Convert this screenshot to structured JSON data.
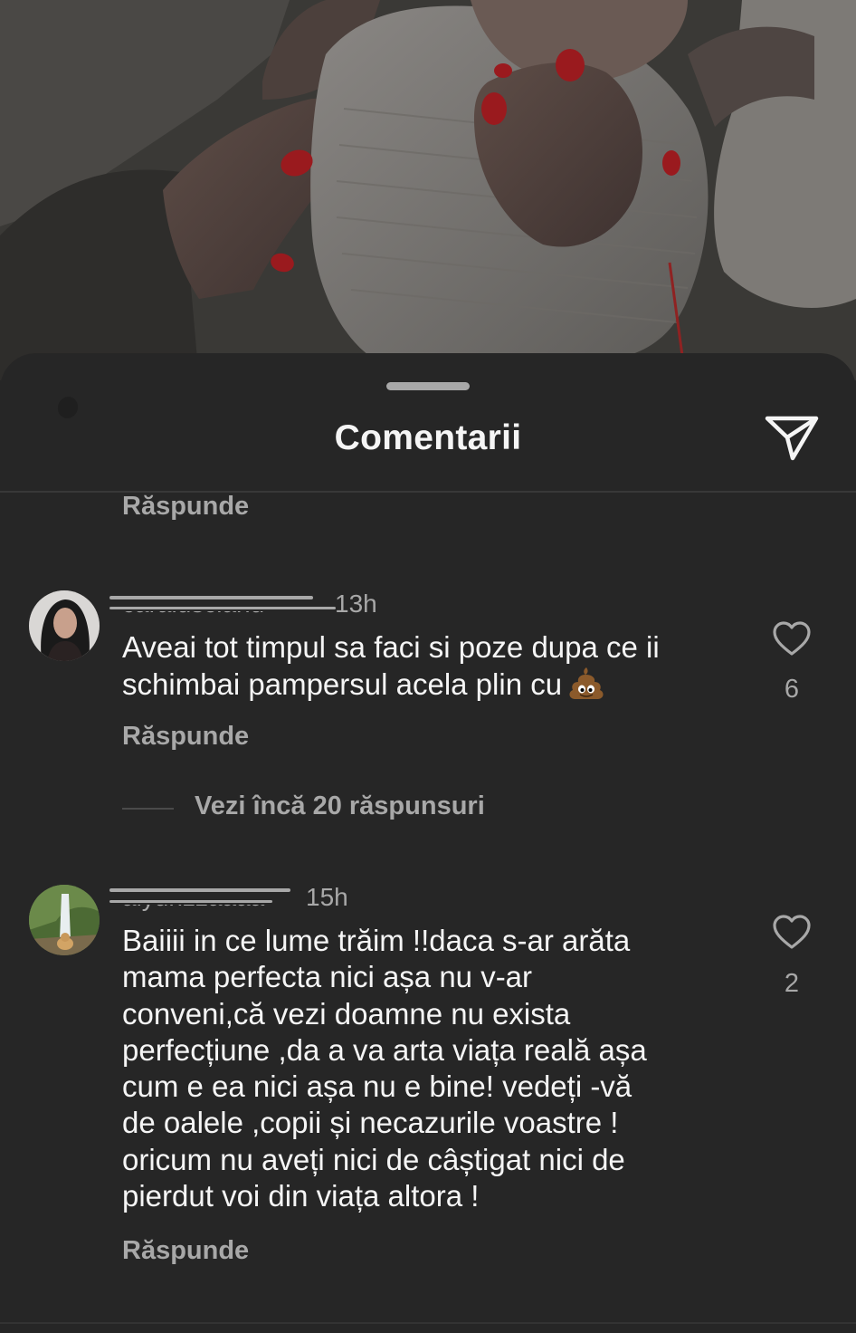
{
  "sheet": {
    "title": "Comentarii",
    "share_icon": "paper-plane-icon"
  },
  "colors": {
    "sheet_bg": "#262626",
    "primary_text": "#f5f5f5",
    "secondary_text": "#a8a8a8",
    "nail_polish": "#b51820"
  },
  "prev_comment": {
    "reply_label": "Răspunde"
  },
  "comments": [
    {
      "username": "caraiuscianu",
      "time": "13h",
      "lines": [
        "Aveai tot timpul sa faci si poze dupa ce ii",
        "schimbai pampersul acela plin cu"
      ],
      "emoji": "pile-of-poo-emoji",
      "likes": "6",
      "reply_label": "Răspunde",
      "view_replies": "Vezi încă 20 răspunsuri"
    },
    {
      "username": "aiyunzzaaaa",
      "time": "15h",
      "lines": [
        "Baiiii in ce lume trăim !!daca s-ar arăta",
        "mama perfecta nici așa nu v-ar",
        "conveni,că vezi doamne nu exista",
        "perfecțiune ,da a va arta viața reală așa",
        "cum e ea nici așa nu e bine! vedeți -vă",
        "de oalele ,copii și necazurile voastre !",
        "oricum nu aveți nici de câștigat nici de",
        "pierdut  voi din viața altora !"
      ],
      "likes": "2",
      "reply_label": "Răspunde"
    }
  ]
}
